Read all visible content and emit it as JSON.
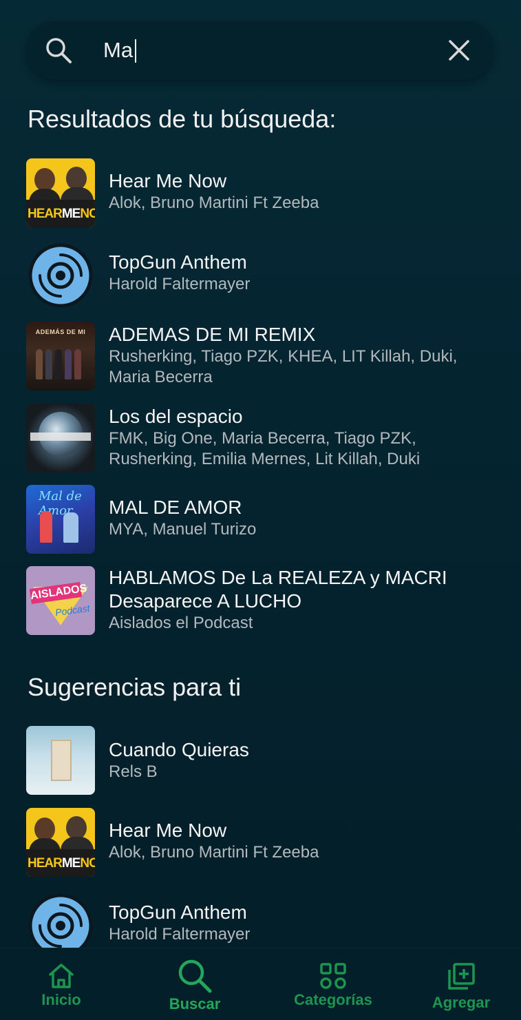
{
  "search": {
    "value": "Ma",
    "placeholder": ""
  },
  "sections": {
    "results_title": "Resultados de tu búsqueda:",
    "suggestions_title": "Sugerencias para ti"
  },
  "results": [
    {
      "title": "Hear Me Now",
      "artist": "Alok, Bruno Martini Ft Zeeba",
      "art_text_a": "HEAR",
      "art_text_b": "ME",
      "art_text_c": "NOW"
    },
    {
      "title": "TopGun Anthem",
      "artist": "Harold Faltermayer"
    },
    {
      "title": "ADEMAS DE MI REMIX",
      "artist_line1": "Rusherking, Tiago PZK, KHEA, LIT Killah, Duki,",
      "artist_line2": "Maria Becerra",
      "art_text": "ADEMÁS DE MI"
    },
    {
      "title": "Los del espacio",
      "artist_line1": "FMK, Big One, Maria Becerra, Tiago PZK,",
      "artist_line2": "Rusherking, Emilia Mernes, Lit Killah, Duki"
    },
    {
      "title": "MAL DE AMOR",
      "artist": "MYA, Manuel Turizo",
      "art_text": "Mal de Amor"
    },
    {
      "title_line1": "HABLAMOS De La REALEZA y MACRI",
      "title_line2": "Desaparece A LUCHO",
      "artist": "Aislados el Podcast",
      "art_text": "AISLADOS",
      "art_text2": "Podcast"
    }
  ],
  "suggestions": [
    {
      "title": "Cuando Quieras",
      "artist": "Rels B"
    },
    {
      "title": "Hear Me Now",
      "artist": "Alok, Bruno Martini Ft Zeeba",
      "art_text_a": "HEAR",
      "art_text_b": "ME",
      "art_text_c": "NOW"
    },
    {
      "title": "TopGun Anthem",
      "artist": "Harold Faltermayer"
    }
  ],
  "nav": {
    "home": "Inicio",
    "search": "Buscar",
    "categories": "Categorías",
    "add": "Agregar"
  },
  "colors": {
    "background": "#03202a",
    "accent": "#1d9550",
    "disc": "#6fb4e8"
  }
}
